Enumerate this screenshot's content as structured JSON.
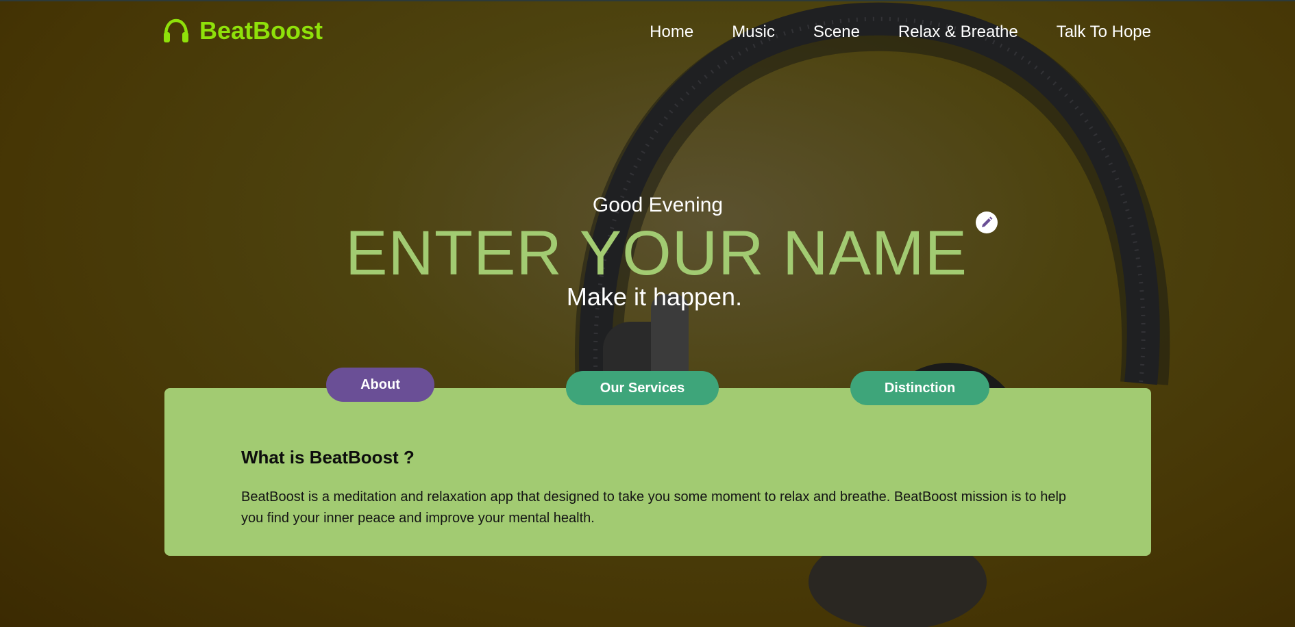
{
  "brand": {
    "name": "BeatBoost",
    "icon": "headphones-icon",
    "color": "#8fe10a"
  },
  "nav": {
    "items": [
      "Home",
      "Music",
      "Scene",
      "Relax & Breathe",
      "Talk To Hope"
    ]
  },
  "hero": {
    "greeting": "Good Evening",
    "name": "ENTER YOUR NAME",
    "edit_icon": "pencil-icon",
    "tagline": "Make it happen."
  },
  "tabs": {
    "about": "About",
    "services": "Our Services",
    "distinction": "Distinction",
    "active": "About"
  },
  "content": {
    "heading": "What is BeatBoost ?",
    "body": "BeatBoost is a meditation and relaxation app that designed to take you some moment to relax and breathe. BeatBoost mission is to help you find your inner peace and improve your mental health."
  },
  "colors": {
    "accent_green": "#a2cb72",
    "tab_active": "#6a4f96",
    "tab_inactive": "#3ea57a"
  }
}
